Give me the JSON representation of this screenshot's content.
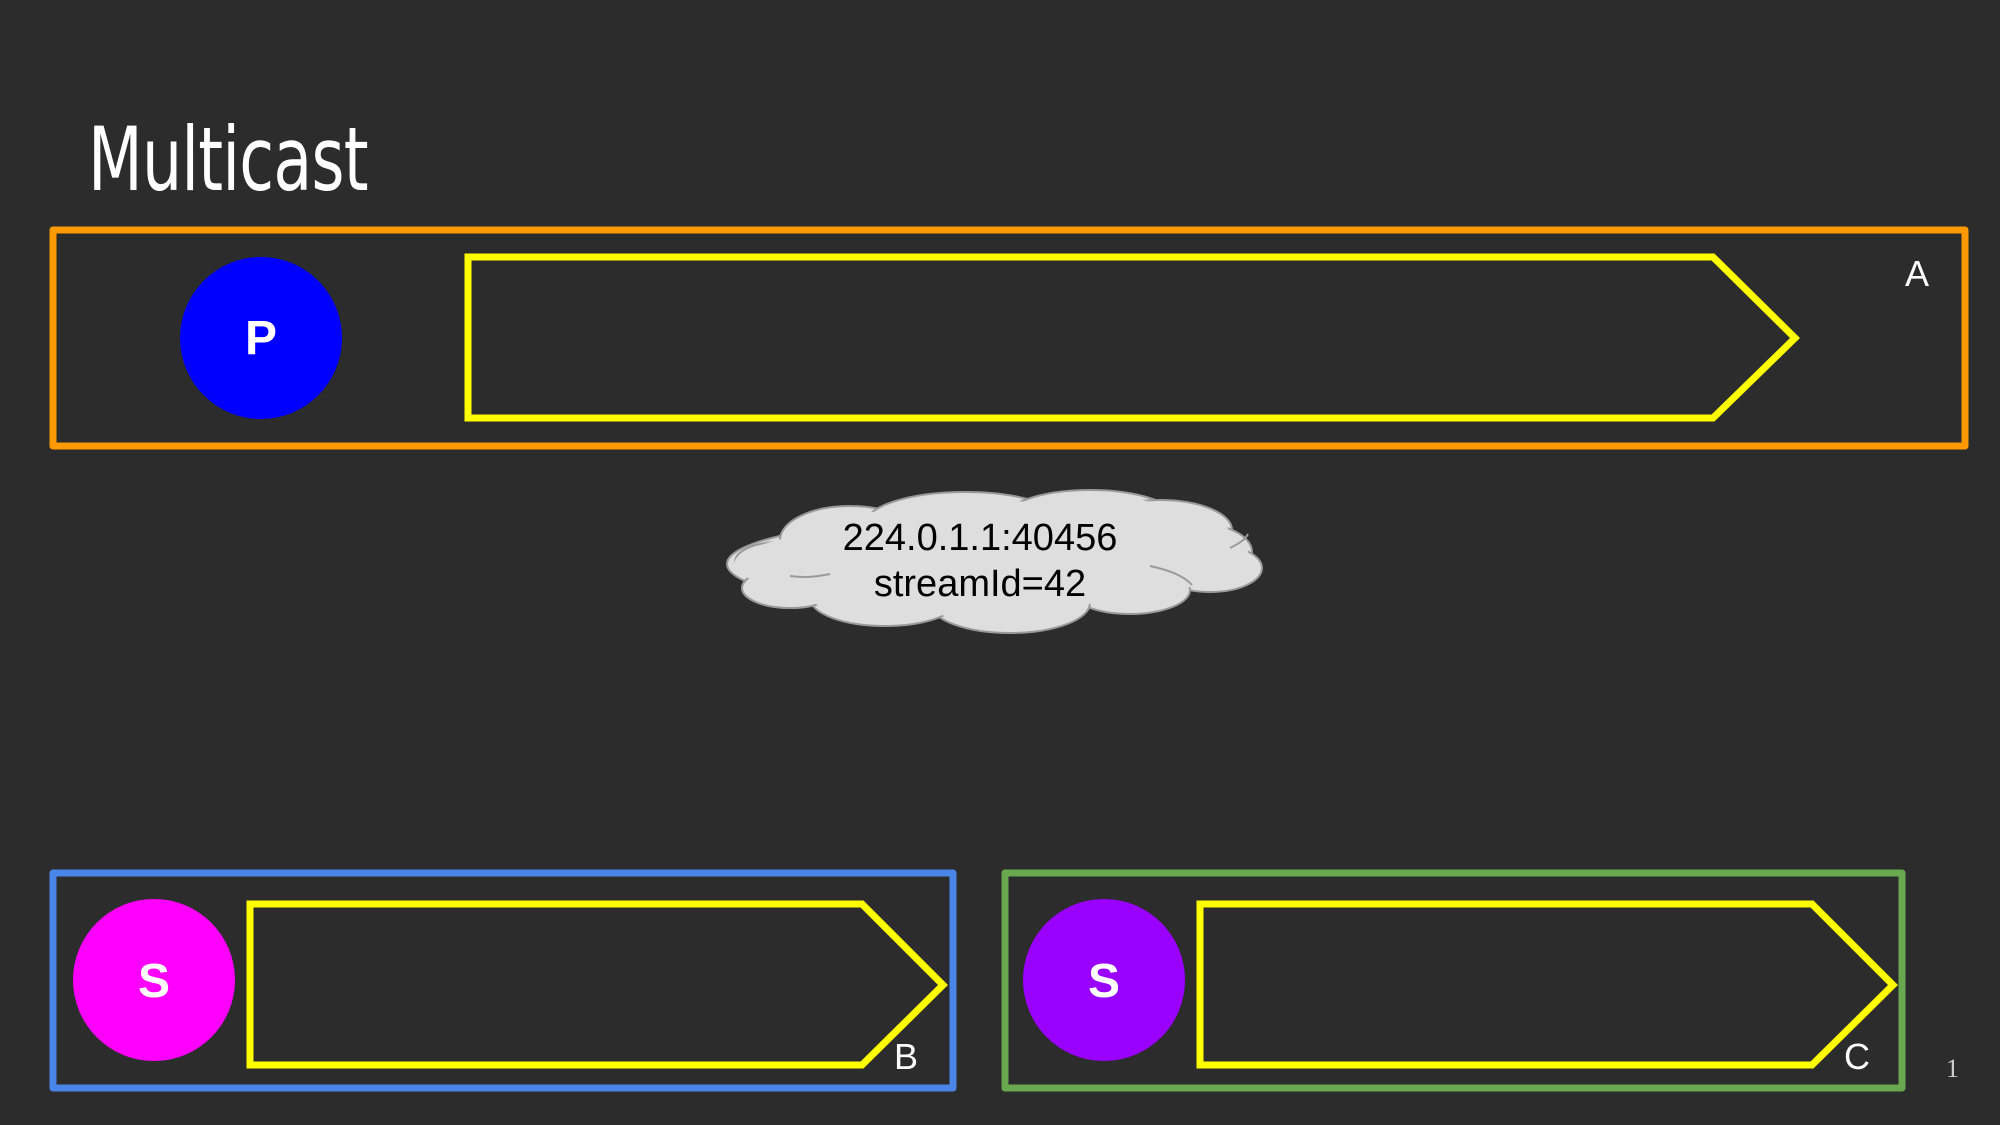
{
  "slide": {
    "title": "Multicast",
    "page_number": "1"
  },
  "top_box": {
    "label": "A",
    "color": "#ff9900",
    "node": {
      "letter": "P",
      "color": "#0000ff"
    },
    "arrow_color": "#ffff00"
  },
  "cloud": {
    "line1": "224.0.1.1:40456",
    "line2": "streamId=42",
    "fill": "#dedede",
    "stroke": "#9a9a9a"
  },
  "bottom_left_box": {
    "label": "B",
    "color": "#4a86e8",
    "node": {
      "letter": "S",
      "color": "#ff00ff"
    },
    "arrow_color": "#ffff00"
  },
  "bottom_right_box": {
    "label": "C",
    "color": "#6aa84f",
    "node": {
      "letter": "S",
      "color": "#9900ff"
    },
    "arrow_color": "#ffff00"
  }
}
